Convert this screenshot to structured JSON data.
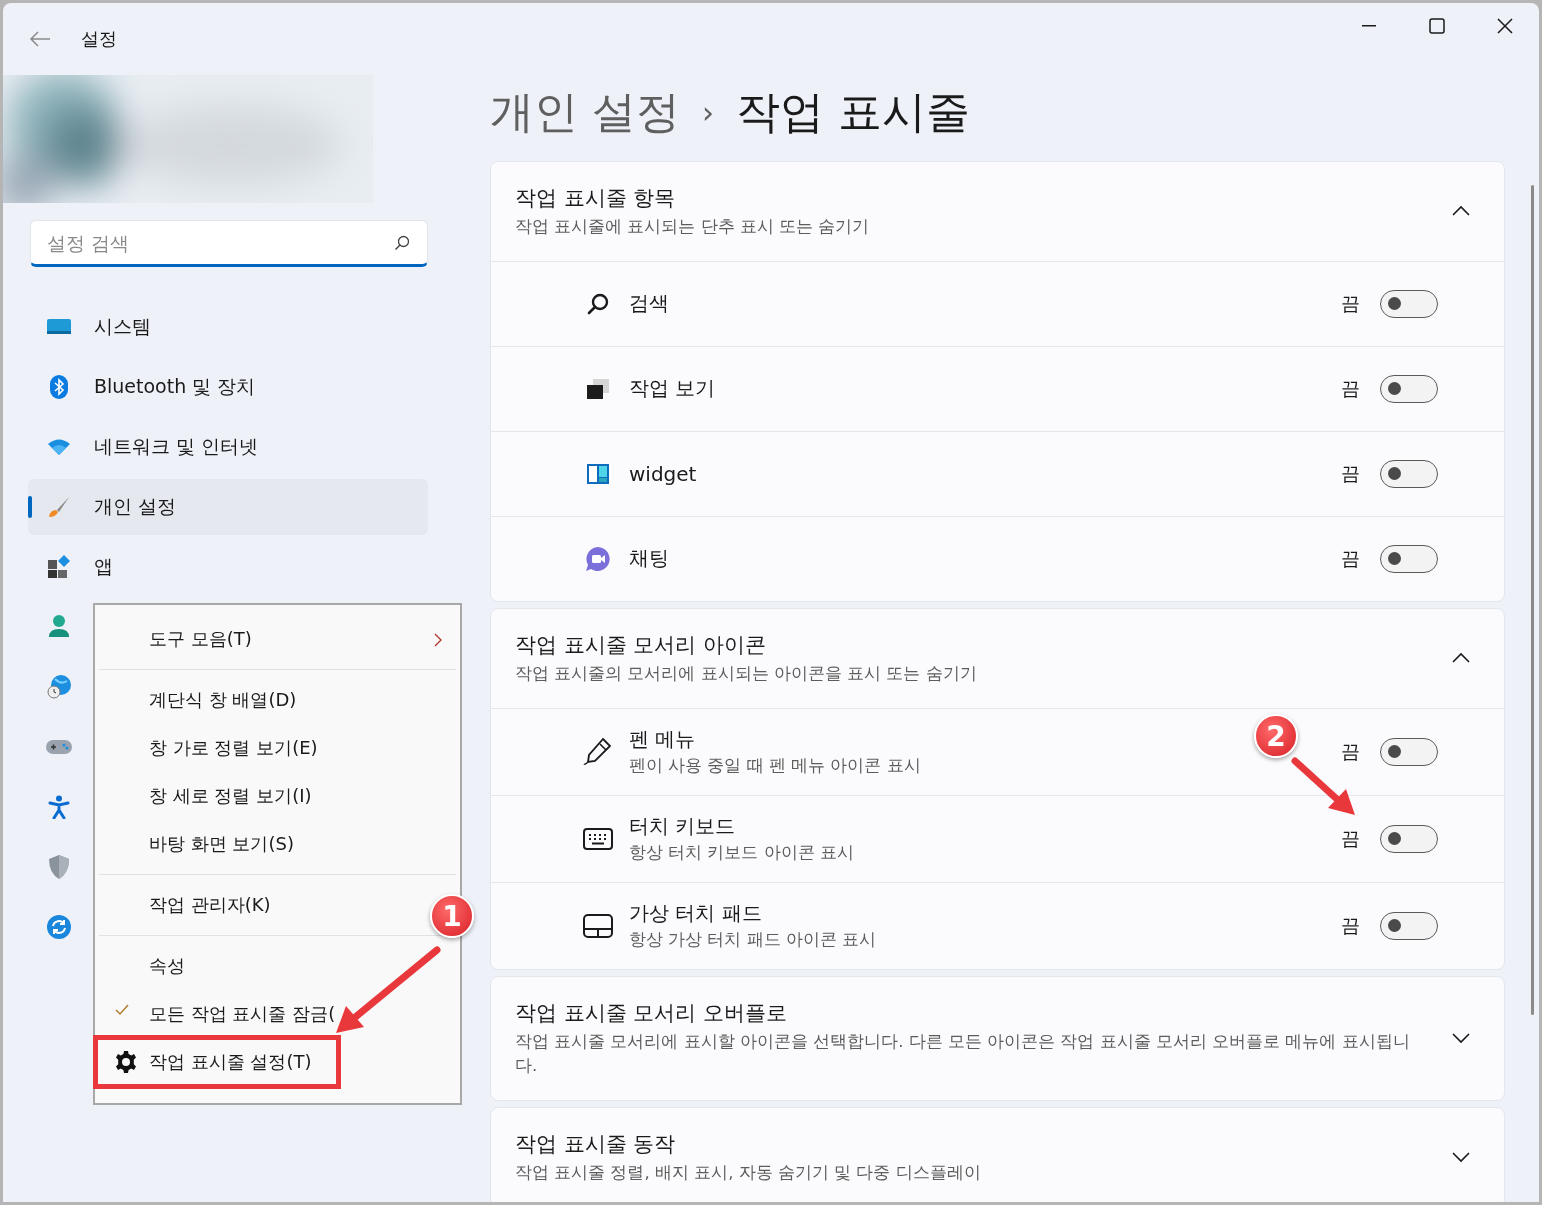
{
  "window": {
    "title": "설정"
  },
  "search": {
    "placeholder": "설정 검색"
  },
  "sidebar": {
    "items": [
      {
        "label": "시스템",
        "selected": false
      },
      {
        "label": "Bluetooth 및 장치",
        "selected": false
      },
      {
        "label": "네트워크 및 인터넷",
        "selected": false
      },
      {
        "label": "개인 설정",
        "selected": true
      },
      {
        "label": "앱",
        "selected": false
      },
      {
        "selected": false
      },
      {
        "selected": false
      },
      {
        "selected": false
      },
      {
        "selected": false
      },
      {
        "selected": false
      },
      {
        "selected": false
      }
    ]
  },
  "breadcrumb": {
    "parent": "개인 설정",
    "separator": "›",
    "current": "작업 표시줄"
  },
  "sections": [
    {
      "title": "작업 표시줄 항목",
      "subtitle": "작업 표시줄에 표시되는 단추 표시 또는 숨기기",
      "expanded": true,
      "rows": [
        {
          "label": "검색",
          "state_text": "끔",
          "on": false
        },
        {
          "label": "작업 보기",
          "state_text": "끔",
          "on": false
        },
        {
          "label": "widget",
          "state_text": "끔",
          "on": false
        },
        {
          "label": "채팅",
          "state_text": "끔",
          "on": false
        }
      ]
    },
    {
      "title": "작업 표시줄 모서리 아이콘",
      "subtitle": "작업 표시줄의 모서리에 표시되는 아이콘을 표시 또는 숨기기",
      "expanded": true,
      "rows": [
        {
          "label": "펜 메뉴",
          "description": "펜이 사용 중일 때 펜 메뉴 아이콘 표시",
          "state_text": "끔",
          "on": false
        },
        {
          "label": "터치 키보드",
          "description": "항상 터치 키보드 아이콘 표시",
          "state_text": "끔",
          "on": false
        },
        {
          "label": "가상 터치 패드",
          "description": "항상 가상 터치 패드 아이콘 표시",
          "state_text": "끔",
          "on": false
        }
      ]
    },
    {
      "title": "작업 표시줄 모서리 오버플로",
      "subtitle": "작업 표시줄 모서리에 표시할 아이콘을 선택합니다. 다른 모든 아이콘은 작업 표시줄 모서리 오버플로 메뉴에 표시됩니다.",
      "expanded": false
    },
    {
      "title": "작업 표시줄 동작",
      "subtitle": "작업 표시줄 정렬, 배지 표시, 자동 숨기기 및 다중 디스플레이",
      "expanded": false
    }
  ],
  "context_menu": {
    "groups": [
      [
        {
          "label": "도구 모음(T)",
          "submenu": true,
          "checked": false,
          "highlighted": false
        }
      ],
      [
        {
          "label": "계단식 창 배열(D)",
          "submenu": false,
          "checked": false,
          "highlighted": false
        },
        {
          "label": "창 가로 정렬 보기(E)",
          "submenu": false,
          "checked": false,
          "highlighted": false
        },
        {
          "label": "창 세로 정렬 보기(I)",
          "submenu": false,
          "checked": false,
          "highlighted": false
        },
        {
          "label": "바탕 화면 보기(S)",
          "submenu": false,
          "checked": false,
          "highlighted": false
        }
      ],
      [
        {
          "label": "작업 관리자(K)",
          "submenu": false,
          "checked": false,
          "highlighted": false
        }
      ],
      [
        {
          "label": "속성",
          "submenu": false,
          "checked": false,
          "highlighted": false
        },
        {
          "label": "모든 작업 표시줄 잠금(",
          "submenu": false,
          "checked": true,
          "highlighted": false
        },
        {
          "label": "작업 표시줄 설정(T)",
          "submenu": false,
          "checked": false,
          "highlighted": true
        }
      ]
    ]
  },
  "annotations": [
    {
      "label": "1"
    },
    {
      "label": "2"
    }
  ]
}
